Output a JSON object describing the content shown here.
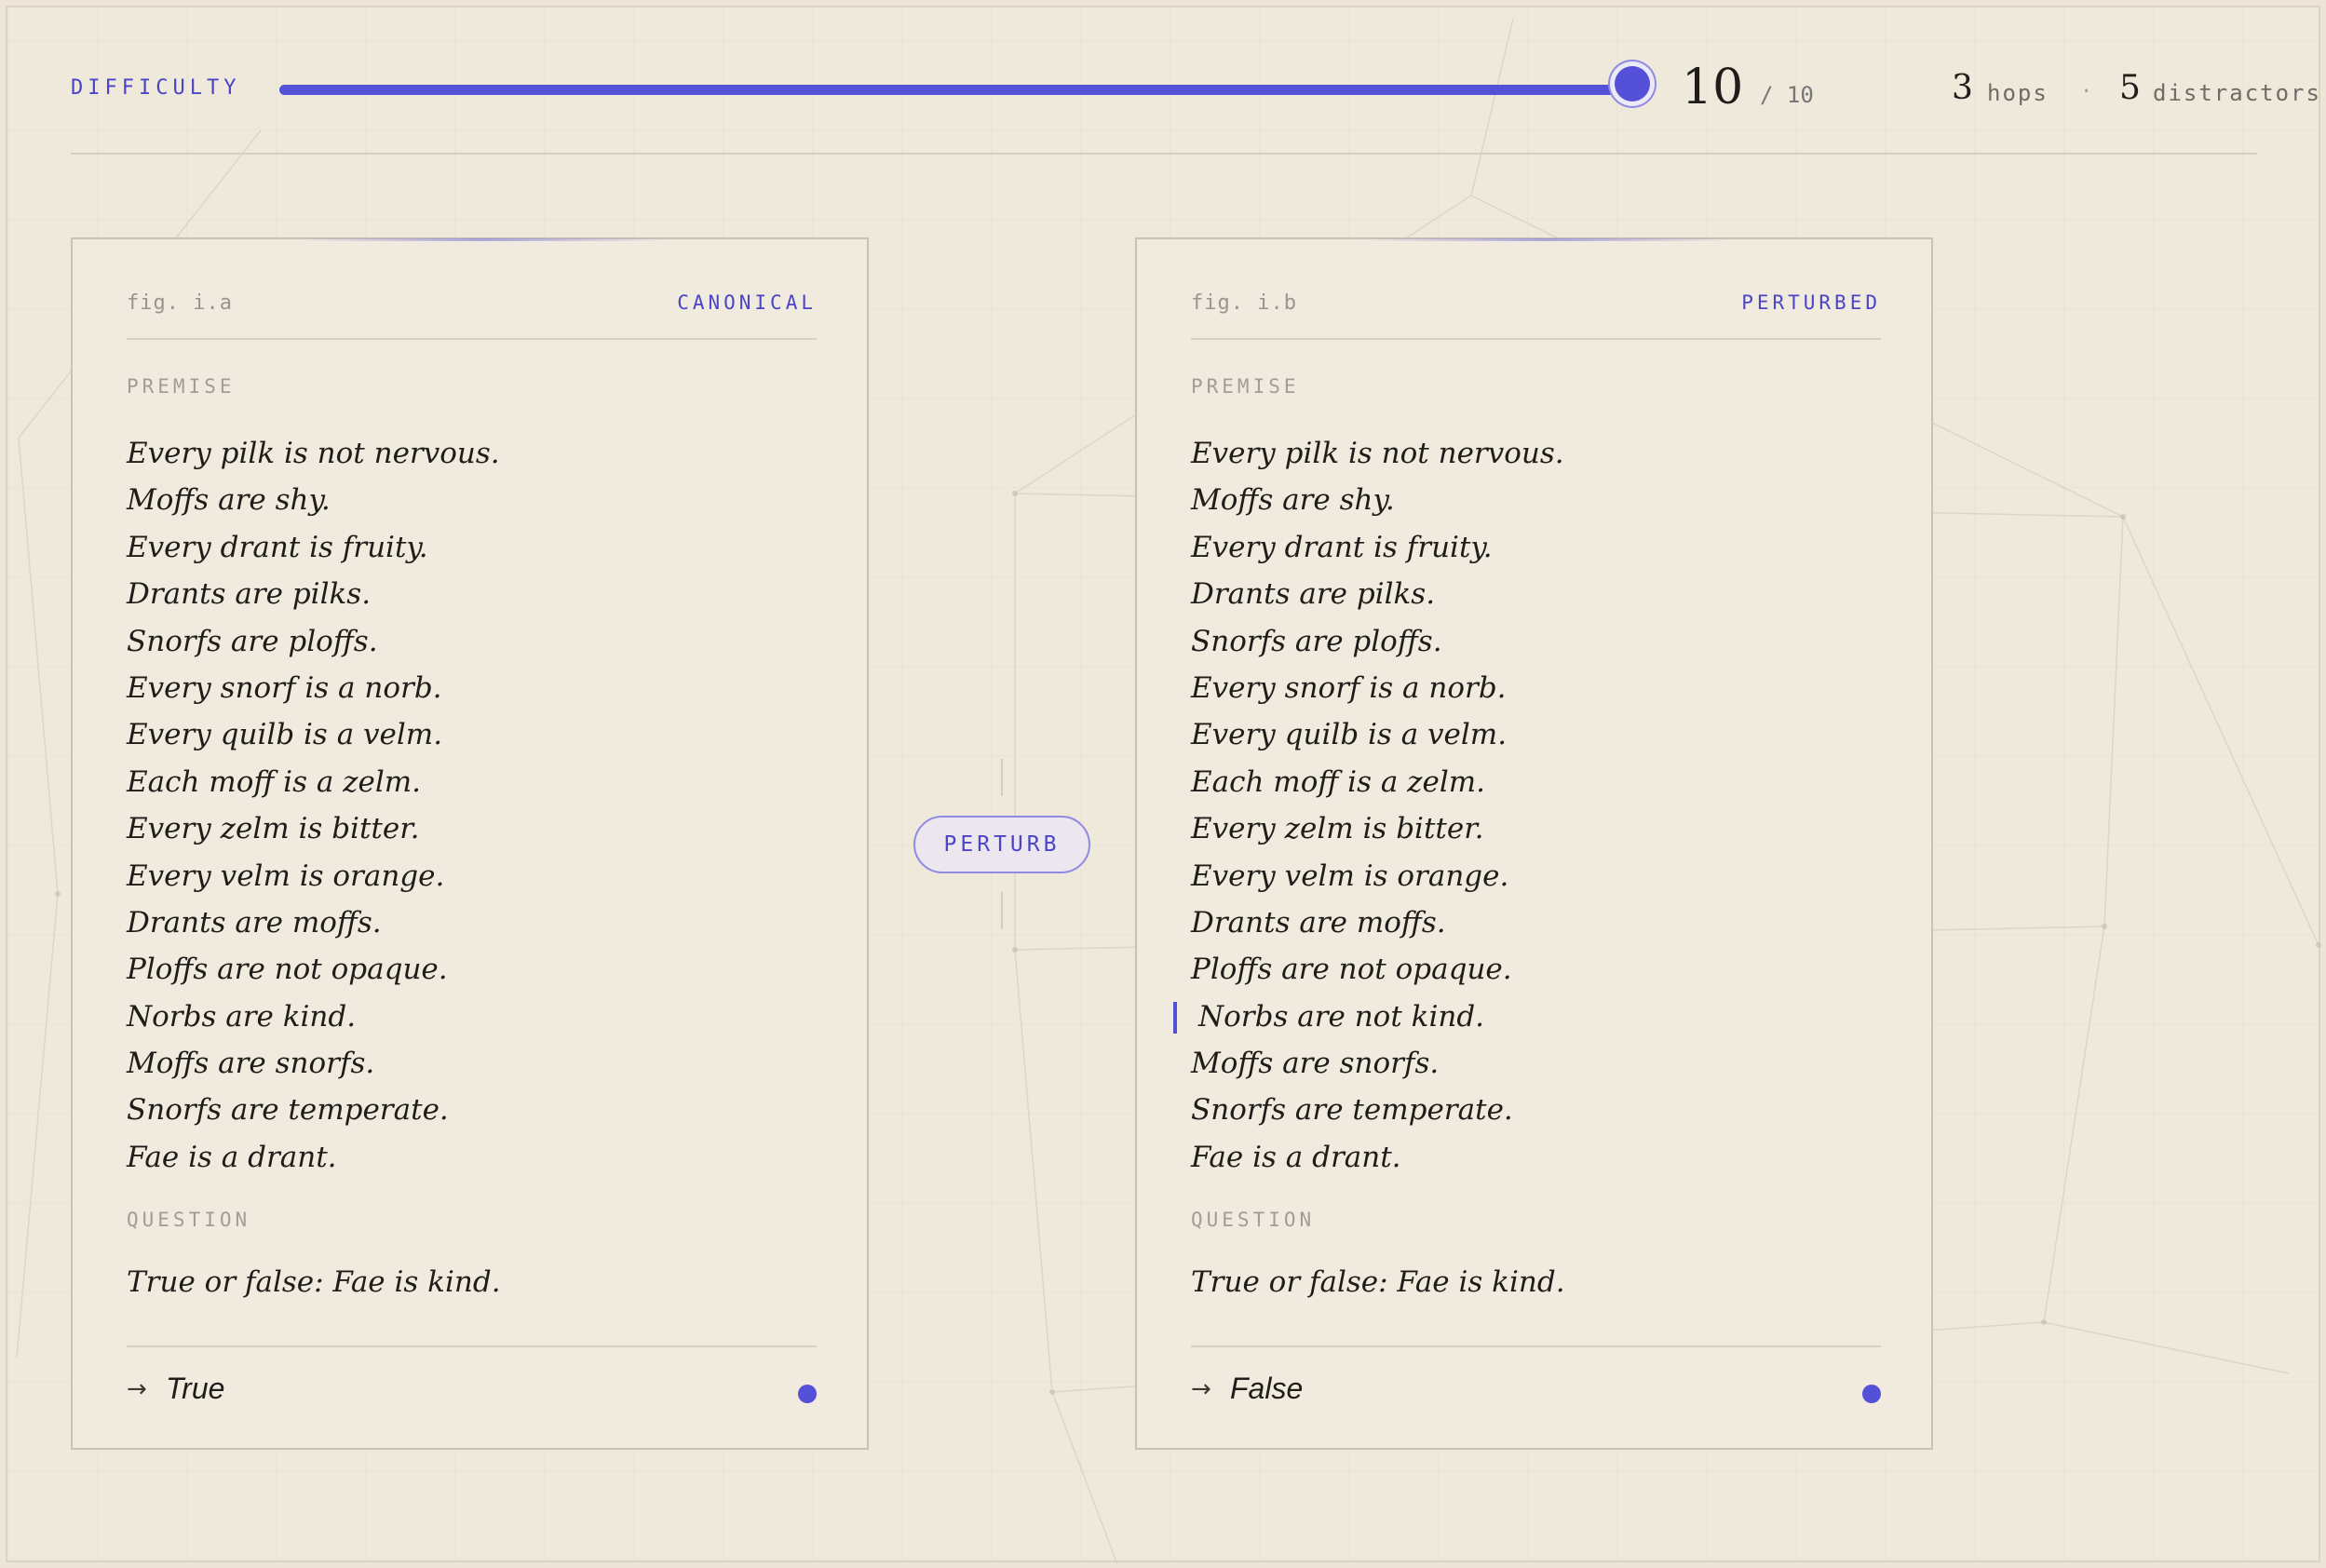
{
  "header": {
    "difficulty_label": "DIFFICULTY",
    "difficulty_value": "10",
    "difficulty_max_text": "/ 10",
    "difficulty_fraction": 1.0,
    "hops_count": "3",
    "hops_label": "hops",
    "separator": "·",
    "distractors_count": "5",
    "distractors_label": "distractors"
  },
  "colors": {
    "accent": "#5450d8",
    "background": "#efe9dc",
    "card_background": "#f1ebdf",
    "text": "#1f1d1a",
    "muted": "#a29d94"
  },
  "controls": {
    "perturb_label": "PERTURB"
  },
  "cards": {
    "left": {
      "fig": "fig. i.a",
      "variant": "CANONICAL",
      "premise_label": "PREMISE",
      "premises": [
        "Every pilk is not nervous.",
        "Moffs are shy.",
        "Every drant is fruity.",
        "Drants are pilks.",
        "Snorfs are ploffs.",
        "Every snorf is a norb.",
        "Every quilb is a velm.",
        "Each moff is a zelm.",
        "Every zelm is bitter.",
        "Every velm is orange.",
        "Drants are moffs.",
        "Ploffs are not opaque.",
        "Norbs are kind.",
        "Moffs are snorfs.",
        "Snorfs are temperate.",
        "Fae is a drant."
      ],
      "question_label": "QUESTION",
      "question": "True or false: Fae is kind.",
      "answer_arrow": "→",
      "answer": "True",
      "answer_icon": "answer-indicator-dot"
    },
    "right": {
      "fig": "fig. i.b",
      "variant": "PERTURBED",
      "premise_label": "PREMISE",
      "premises": [
        "Every pilk is not nervous.",
        "Moffs are shy.",
        "Every drant is fruity.",
        "Drants are pilks.",
        "Snorfs are ploffs.",
        "Every snorf is a norb.",
        "Every quilb is a velm.",
        "Each moff is a zelm.",
        "Every zelm is bitter.",
        "Every velm is orange.",
        "Drants are moffs.",
        "Ploffs are not opaque.",
        "Norbs are not kind.",
        "Moffs are snorfs.",
        "Snorfs are temperate.",
        "Fae is a drant."
      ],
      "changed_premise_index": 12,
      "question_label": "QUESTION",
      "question": "True or false: Fae is kind.",
      "answer_arrow": "→",
      "answer": "False",
      "answer_icon": "answer-indicator-dot"
    }
  }
}
